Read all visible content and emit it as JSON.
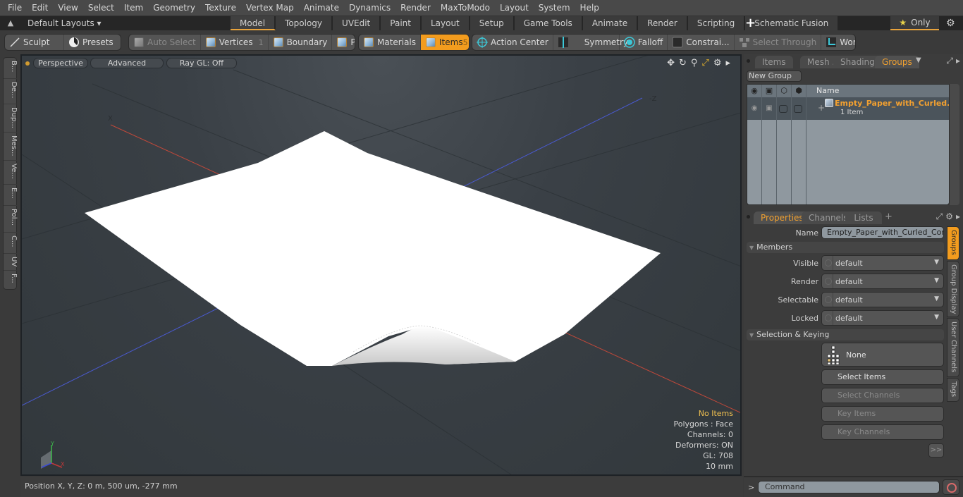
{
  "menu": [
    "File",
    "Edit",
    "View",
    "Select",
    "Item",
    "Geometry",
    "Texture",
    "Vertex Map",
    "Animate",
    "Dynamics",
    "Render",
    "MaxToModo",
    "Layout",
    "System",
    "Help"
  ],
  "layoutbar": {
    "layouts_label": "Default Layouts ▾",
    "tabs": [
      "Model",
      "Topology",
      "UVEdit",
      "Paint",
      "Layout",
      "Setup",
      "Game Tools",
      "Animate",
      "Render",
      "Scripting",
      "Schematic Fusion"
    ],
    "active_tab": "Model",
    "only_label": "Only",
    "accent": "#e8a33c"
  },
  "toolbar": {
    "sculpt": "Sculpt",
    "presets": "Presets",
    "auto_select": "Auto Select",
    "vertices": "Vertices",
    "vertices_count": "1",
    "boundary": "Boundary",
    "polygons": "Polygons",
    "materials": "Materials",
    "items": "Items",
    "items_count": "5",
    "action_center": "Action Center",
    "symmetry": "Symmetry",
    "falloff": "Falloff",
    "constraints": "Constrai...",
    "select_through": "Select Through",
    "workplane": "WorkPlane",
    "active_color": "#f39c1e"
  },
  "left_tabs": [
    "B...",
    "De...",
    "Dup...",
    "Mes...",
    "Ve...",
    "E...",
    "Pol...",
    "C...",
    "UV",
    "F..."
  ],
  "viewport": {
    "perspective": "Perspective",
    "advanced": "Advanced",
    "raygl": "Ray GL: Off",
    "axis_x_label": "X",
    "axis_z_label": "-Z",
    "info": {
      "no_items": "No Items",
      "polygons": "Polygons : Face",
      "channels": "Channels: 0",
      "deformers": "Deformers: ON",
      "gl": "GL: 708",
      "scale": "10 mm"
    }
  },
  "statusbar": {
    "position": "Position X, Y, Z:   0 m, 500 um, -277 mm"
  },
  "groups_panel": {
    "tabs": [
      "Items",
      "Mesh ...",
      "Shading",
      "Groups"
    ],
    "active_tab": "Groups",
    "new_group": "New Group",
    "name_header": "Name",
    "group_name": "Empty_Paper_with_Curled...",
    "group_sub": "1 Item"
  },
  "properties_panel": {
    "tabs": [
      "Properties",
      "Channels",
      "Lists"
    ],
    "active_tab": "Properties",
    "name_label": "Name",
    "name_value": "Empty_Paper_with_Curled_Corne",
    "members_section": "Members",
    "visible_label": "Visible",
    "visible_value": "default",
    "render_label": "Render",
    "render_value": "default",
    "selectable_label": "Selectable",
    "selectable_value": "default",
    "locked_label": "Locked",
    "locked_value": "default",
    "selection_section": "Selection & Keying",
    "none_label": "None",
    "select_items": "Select Items",
    "select_channels": "Select Channels",
    "key_items": "Key Items",
    "key_channels": "Key Channels",
    "expand": ">>",
    "side_tabs": [
      "Groups",
      "Group Display",
      "User Channels",
      "Tags"
    ],
    "active_side_tab": "Groups"
  },
  "command": {
    "prompt": ">",
    "placeholder": "Command"
  }
}
